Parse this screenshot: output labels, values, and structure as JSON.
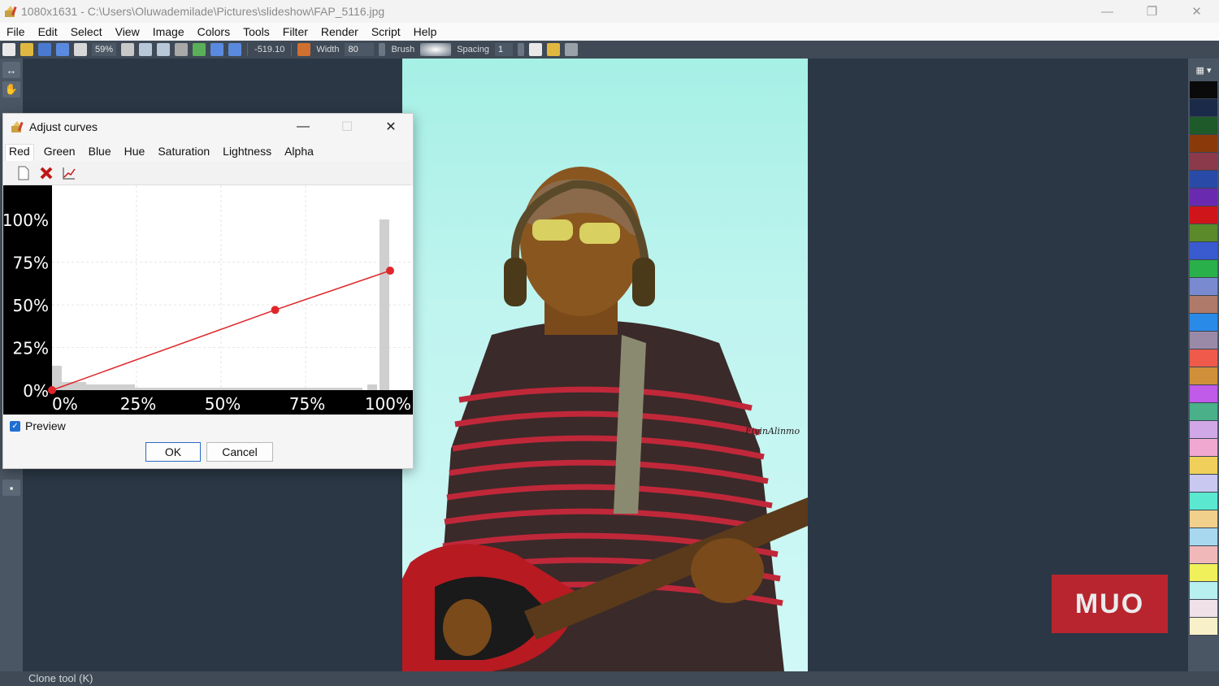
{
  "window": {
    "title": "1080x1631 - C:\\Users\\Oluwademilade\\Pictures\\slideshow\\FAP_5116.jpg",
    "controls": [
      "—",
      "❐",
      "✕"
    ]
  },
  "menu": [
    "File",
    "Edit",
    "Select",
    "View",
    "Image",
    "Colors",
    "Tools",
    "Filter",
    "Render",
    "Script",
    "Help"
  ],
  "toolbar": {
    "zoom": "59%",
    "angle": "-519.10",
    "width_label": "Width",
    "width_value": "80",
    "brush_label": "Brush",
    "spacing_label": "Spacing",
    "spacing_value": "1"
  },
  "dialog": {
    "title": "Adjust curves",
    "tabs": [
      "Red",
      "Green",
      "Blue",
      "Hue",
      "Saturation",
      "Lightness",
      "Alpha"
    ],
    "active_tab": "Red",
    "preview_label": "Preview",
    "preview_checked": true,
    "ok_label": "OK",
    "cancel_label": "Cancel",
    "curve": {
      "y_ticks": [
        "100%",
        "75%",
        "50%",
        "25%",
        "0%"
      ],
      "x_ticks": [
        "0%",
        "25%",
        "50%",
        "75%",
        "100%"
      ],
      "points": [
        [
          0,
          0
        ],
        [
          0.66,
          0.47
        ],
        [
          1.0,
          0.7
        ]
      ],
      "curve_color": "#e0262b"
    }
  },
  "photo": {
    "signature": "FiyinAlinmo"
  },
  "watermark": "MUO",
  "palette_colors": [
    "#0a0a0a",
    "#1c2a4a",
    "#1e5a2a",
    "#8a3a0a",
    "#8a3a4a",
    "#2a4aa8",
    "#6a2ab0",
    "#d0151a",
    "#5a8a2a",
    "#3a5ad0",
    "#2ab04a",
    "#7a8ad0",
    "#b07a6a",
    "#2a8ae8",
    "#9a8aa8",
    "#f05a4a",
    "#d0903a",
    "#c05ae8",
    "#4ab08a",
    "#d0a8e8",
    "#f0a8d0",
    "#f0d05a",
    "#c8c8f0",
    "#5ae8d0",
    "#f0d08a",
    "#a8d8f0",
    "#f0b8b8",
    "#f0f05a",
    "#b8f0f0",
    "#f0e0e8",
    "#f8f0c8"
  ],
  "status": "Clone tool (K)"
}
